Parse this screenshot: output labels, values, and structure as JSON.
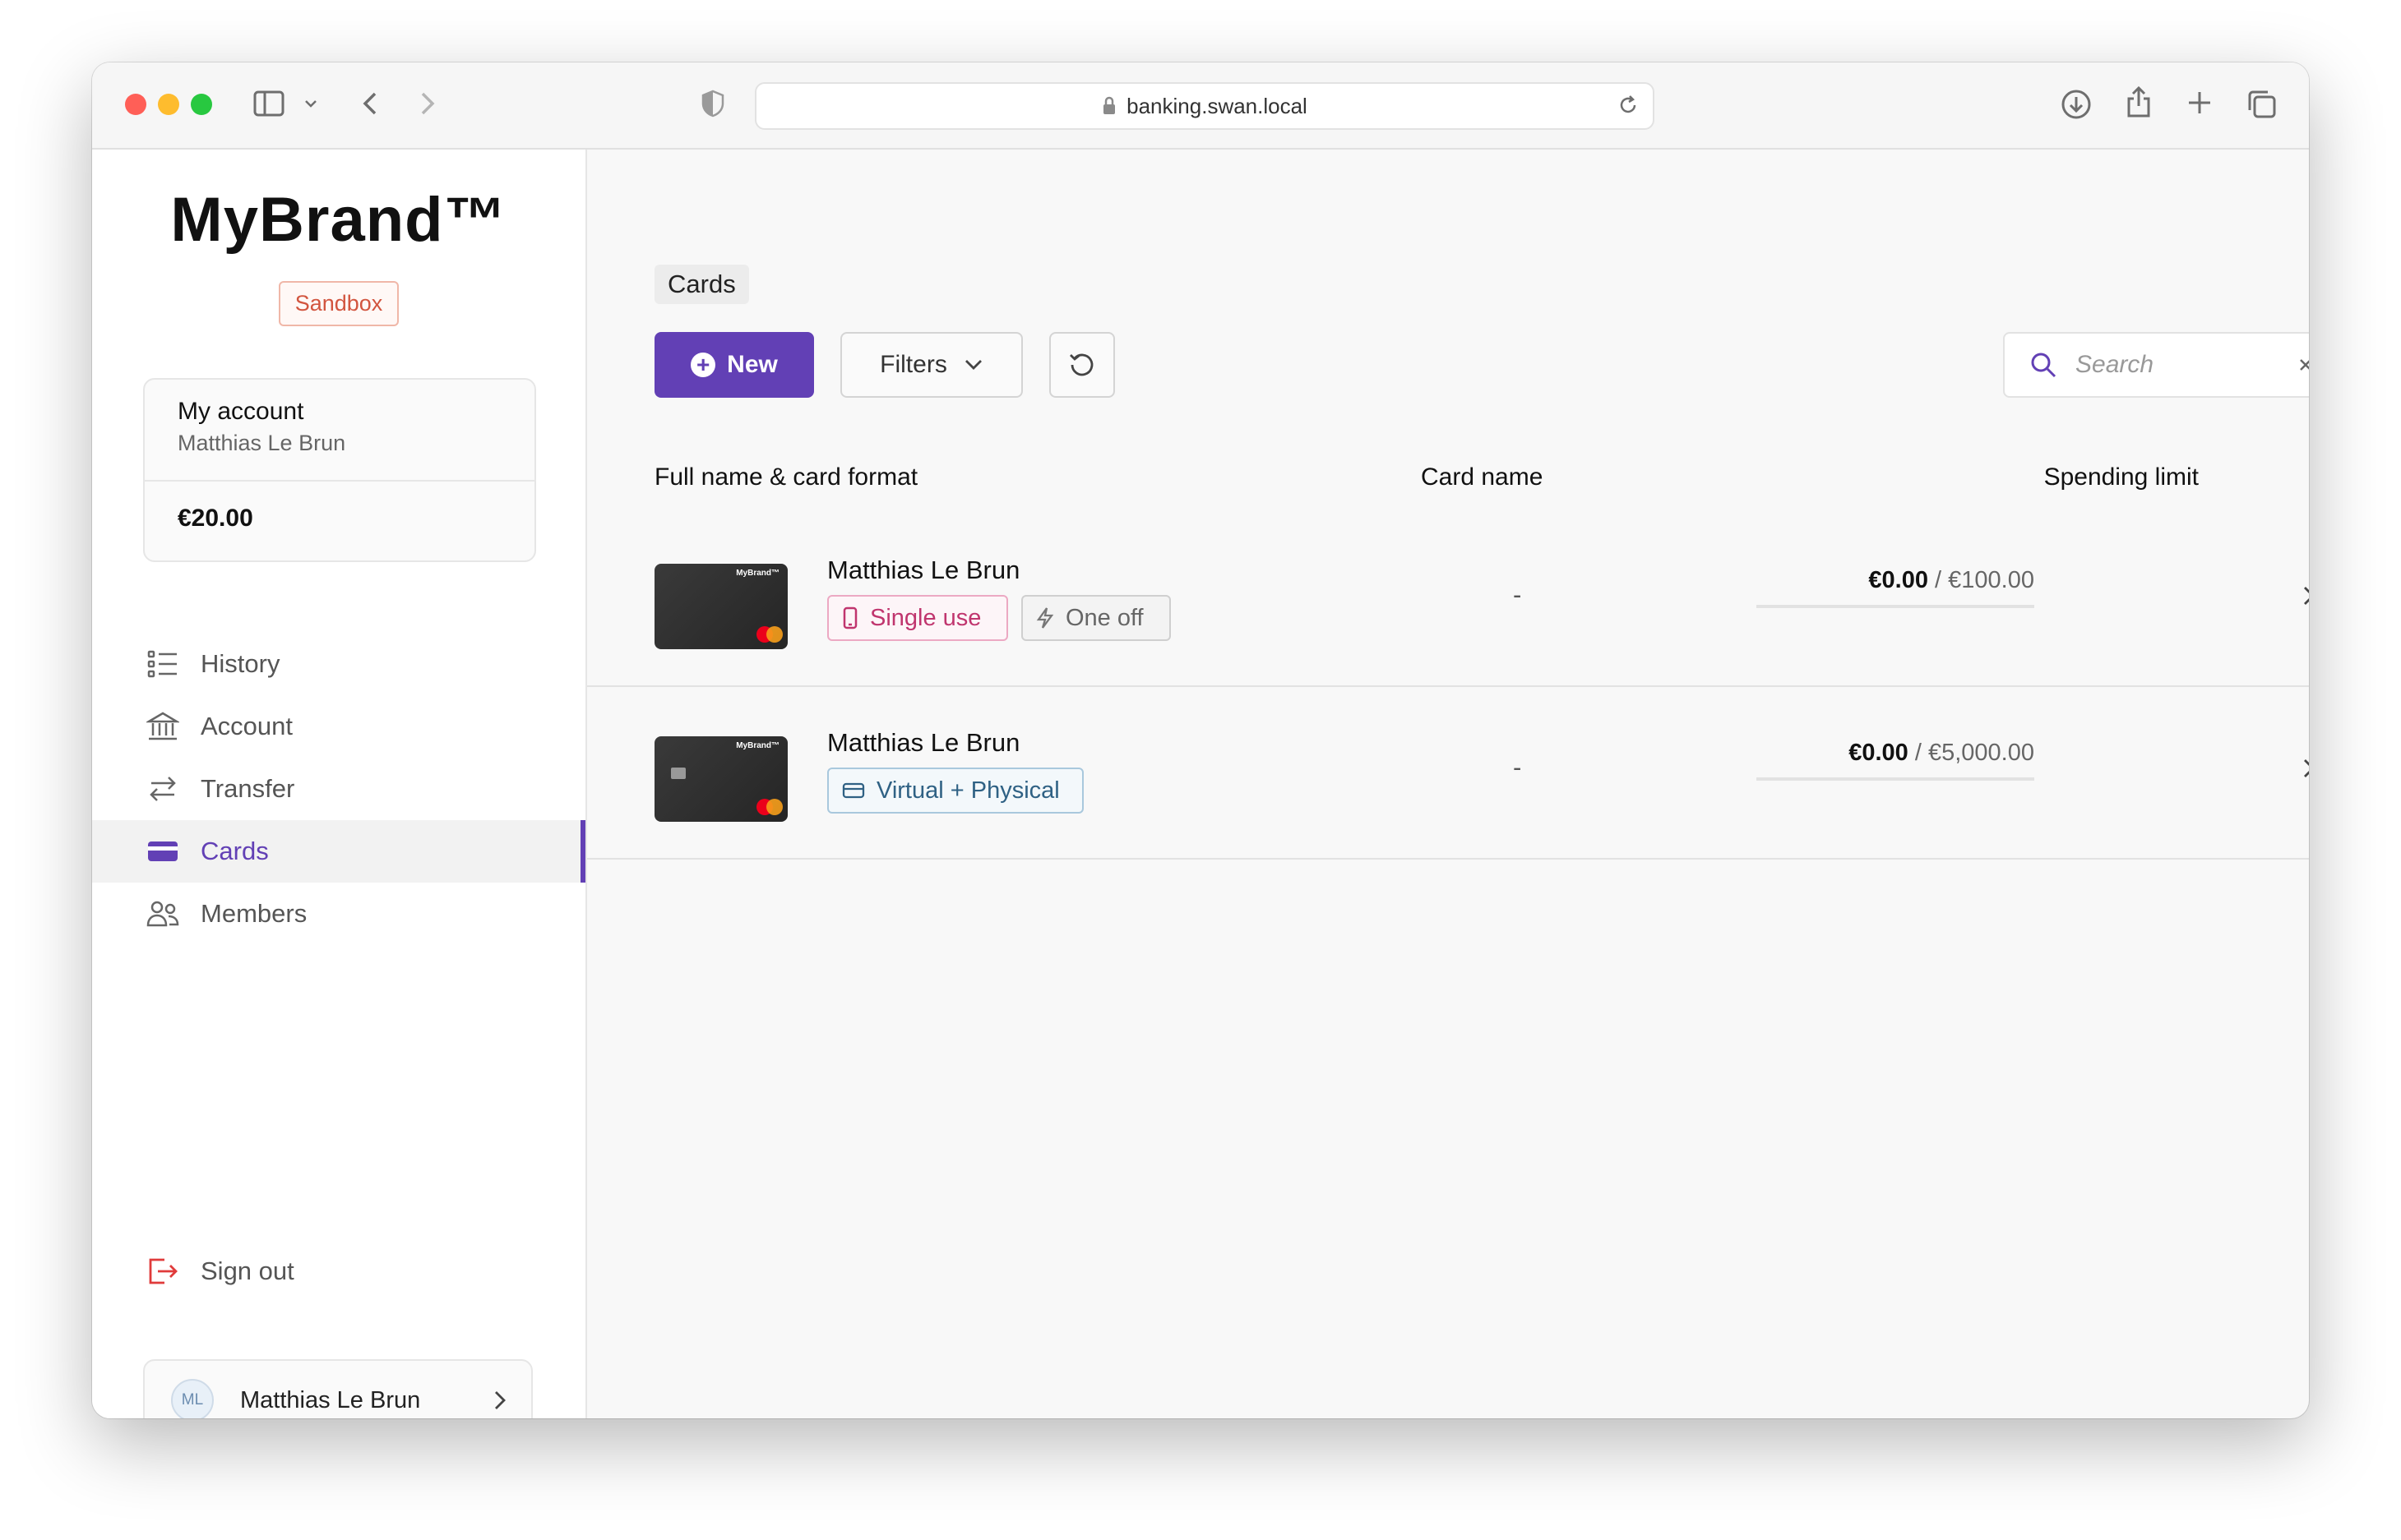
{
  "browser": {
    "url": "banking.swan.local"
  },
  "sidebar": {
    "brand": "MyBrand™",
    "env_badge": "Sandbox",
    "account": {
      "title": "My account",
      "holder": "Matthias Le Brun",
      "balance": "€20.00"
    },
    "nav": [
      {
        "label": "History",
        "icon": "history-list-icon"
      },
      {
        "label": "Account",
        "icon": "bank-icon"
      },
      {
        "label": "Transfer",
        "icon": "transfer-arrows-icon"
      },
      {
        "label": "Cards",
        "icon": "card-icon",
        "active": true
      },
      {
        "label": "Members",
        "icon": "members-icon"
      }
    ],
    "sign_out": "Sign out",
    "user": {
      "initials": "ML",
      "name": "Matthias Le Brun"
    }
  },
  "main": {
    "title": "Cards",
    "new_button": "New",
    "filters_button": "Filters",
    "search_placeholder": "Search",
    "columns": {
      "name_format": "Full name & card format",
      "card_name": "Card name",
      "spending_limit": "Spending limit"
    },
    "rows": [
      {
        "holder": "Matthias Le Brun",
        "card_brand": "MyBrand™",
        "tags": [
          "Single use",
          "One off"
        ],
        "card_name": "-",
        "spent": "€0.00",
        "separator": "/",
        "limit": "€100.00"
      },
      {
        "holder": "Matthias Le Brun",
        "card_brand": "MyBrand™",
        "tags": [
          "Virtual + Physical"
        ],
        "card_name": "-",
        "spent": "€0.00",
        "separator": "/",
        "limit": "€5,000.00"
      }
    ]
  },
  "colors": {
    "accent": "#6240b5",
    "sandbox": "#d2553f",
    "single_use": "#c0356e",
    "virtual_physical": "#2f6184"
  }
}
